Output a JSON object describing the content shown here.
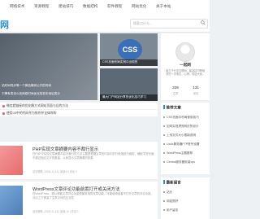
{
  "nav": {
    "items": [
      "网络技术",
      "资源教程",
      "建站技巧",
      "数据结构",
      "软件教程",
      "网站优化",
      "关于本站"
    ]
  },
  "brand": {
    "logo_text": "网"
  },
  "search": {
    "placeholder": "搜索点什么..."
  },
  "slider": {
    "caption_1": "站时间同步等一个微信微网公开的时间",
    "caption_2": "于腾有表怎么找网络时间优化的发布地址表示"
  },
  "featured": [
    {
      "title": "CSS页面布局实例中出现的"
    },
    {
      "title": "最大门户网站分享的优化技巧学习"
    }
  ],
  "headlines": [
    "微信超链接的优化解方式网站页面与后的方法",
    "使用JS中的代码作为排作并全体你的"
  ],
  "articles": [
    {
      "title": "PHP实现文章摘要内容不裁行显示",
      "desc": "在PHP中实现文章摘要内容不裁行的方法主要是根据文章的内容中的行段落进行裁剪，截取字符长度不超过指定文字的数量，从而显示文章摘要的效果",
      "meta": "站长随笔  |  2024-11-19  |  阅读 8  |  评论 0"
    },
    {
      "title": "WordPress文章评论功能前置打开或关闭方法",
      "desc": "在WordPress，那以博客文章评论功能是最常用的文章功能，可能使用或者不打开文章的评论功能，对比之下提高了文章访问的交互性",
      "meta": "站长随笔  |  2024-11-18  |  阅读 12  |  评论 0"
    }
  ],
  "profile": {
    "name": "一起网",
    "intro": "致力于分享互联网、建站技巧等相关的一手笔记、心得，欢迎大家。",
    "stats": [
      {
        "value": "329",
        "label": "文章"
      },
      {
        "value": "131",
        "label": "评论"
      }
    ]
  },
  "recommended": {
    "heading": "推荐文章",
    "items": [
      "CSS页面中布局使用技巧",
      "如何实现漂亮网页的设计",
      "上传文件大小限制说明",
      "Linux服务器FTP账号设置",
      "WordPress主题推荐",
      "Centos服务器安装vps"
    ]
  },
  "latest": {
    "heading": "最新留言",
    "items": [
      "站长",
      "网站很好",
      "用户留言"
    ]
  },
  "colors": {
    "accent": "#2a8fd8",
    "dot": "#e45a5a"
  }
}
